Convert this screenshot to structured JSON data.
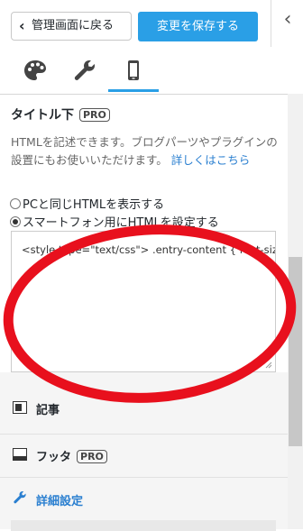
{
  "header": {
    "back_label": "管理画面に戻る",
    "save_label": "変更を保存する",
    "collapse_glyph": "‹"
  },
  "tabs": [
    {
      "name": "palette-icon",
      "active": false
    },
    {
      "name": "wrench-icon",
      "active": false
    },
    {
      "name": "smartphone-icon",
      "active": true
    }
  ],
  "section": {
    "title": "タイトル下",
    "badge": "PRO",
    "description": "HTMLを記述できます。ブログパーツやプラグインの設置にもお使いいただけます。",
    "link_text": "詳しくはこちら",
    "options": [
      {
        "label": "PCと同じHTMLを表示する",
        "selected": false
      },
      {
        "label": "スマートフォン用にHTMLを設定する",
        "selected": true
      }
    ],
    "code": "<style type=\"text/css\"> .entry-content { font-size"
  },
  "panels": {
    "article": {
      "label": "記事"
    },
    "footer": {
      "label": "フッタ",
      "badge": "PRO"
    },
    "detail": {
      "label": "詳細設定"
    }
  },
  "colors": {
    "accent": "#2a9fe6",
    "link": "#2a7fd0",
    "annotation": "#e8101d"
  }
}
